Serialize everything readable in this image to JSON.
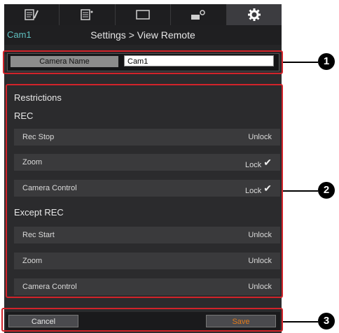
{
  "header": {
    "camera_label": "Cam1",
    "breadcrumb": "Settings > View Remote"
  },
  "tabs": [
    {
      "name": "edit-clip-icon"
    },
    {
      "name": "clip-list-icon"
    },
    {
      "name": "view-icon"
    },
    {
      "name": "camera-settings-icon"
    },
    {
      "name": "settings-gear-icon"
    }
  ],
  "camera_name": {
    "label": "Camera Name",
    "value": "Cam1"
  },
  "restrictions": {
    "title": "Restrictions",
    "rec": {
      "title": "REC",
      "rows": [
        {
          "label": "Rec Stop",
          "value": "Unlock",
          "checked": false
        },
        {
          "label": "Zoom",
          "value": "Lock",
          "checked": true
        },
        {
          "label": "Camera Control",
          "value": "Lock",
          "checked": true
        }
      ]
    },
    "except_rec": {
      "title": "Except REC",
      "rows": [
        {
          "label": "Rec Start",
          "value": "Unlock"
        },
        {
          "label": "Zoom",
          "value": "Unlock"
        },
        {
          "label": "Camera Control",
          "value": "Unlock"
        }
      ]
    }
  },
  "footer": {
    "cancel_label": "Cancel",
    "save_label": "Save"
  },
  "callouts": [
    "1",
    "2",
    "3"
  ],
  "colors": {
    "highlight_box": "#d2232a",
    "save_text": "#e07a1a"
  }
}
